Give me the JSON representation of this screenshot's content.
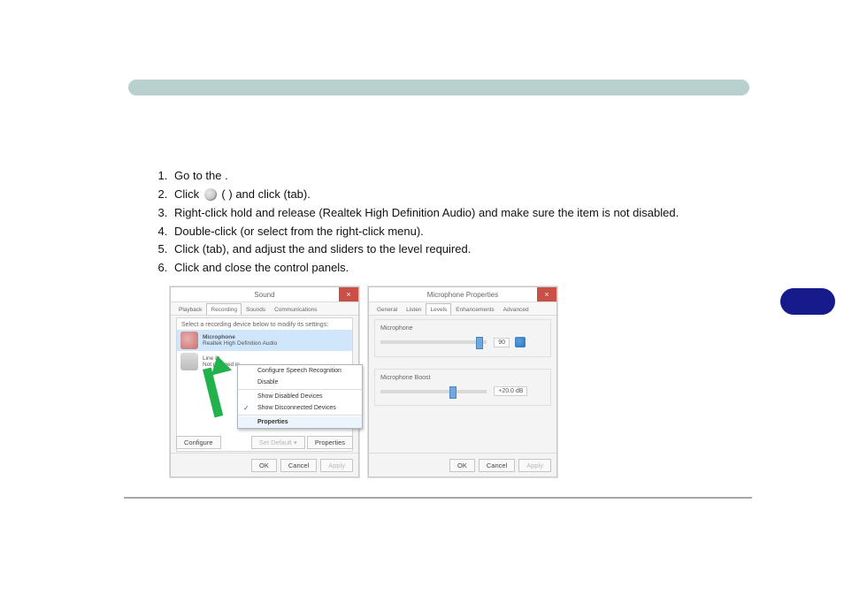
{
  "steps": {
    "s1": {
      "a": "Go to the",
      "b": ""
    },
    "s2": {
      "a": "Click",
      "b": "",
      "c": "and click",
      "d": ""
    },
    "s3": {
      "a": "Right-click hold and release",
      "b": "",
      "c": "(Realtek High Definition Audio) and",
      "d": "make sure the item is not disabled."
    },
    "s4": {
      "a": "Double-click",
      "b": "",
      "c": ""
    },
    "s5": {
      "a": "Click",
      "b": "",
      "c": "",
      "d": ""
    },
    "s6": {
      "a": "Click",
      "b": "",
      "c": "and close the control panels."
    }
  },
  "sound": {
    "title": "Sound",
    "tabs": [
      "Playback",
      "Recording",
      "Sounds",
      "Communications"
    ],
    "desc": "Select a recording device below to modify its settings:",
    "devices": [
      {
        "name": "Microphone",
        "sub": "Realtek High Definition Audio"
      },
      {
        "name": "Line In",
        "sub": "Not plugged in"
      }
    ],
    "menu": [
      "Configure Speech Recognition",
      "Disable",
      "Show Disabled Devices",
      "Show Disconnected Devices",
      "Properties"
    ],
    "lower": {
      "configure": "Configure",
      "setdefault": "Set Default  ▾",
      "properties": "Properties"
    }
  },
  "mic": {
    "title": "Microphone Properties",
    "tabs": [
      "General",
      "Listen",
      "Levels",
      "Enhancements",
      "Advanced"
    ],
    "level": {
      "label": "Microphone",
      "value": "90"
    },
    "boost": {
      "label": "Microphone Boost",
      "value": "+20.0 dB"
    }
  },
  "common": {
    "ok": "OK",
    "cancel": "Cancel",
    "apply": "Apply"
  }
}
